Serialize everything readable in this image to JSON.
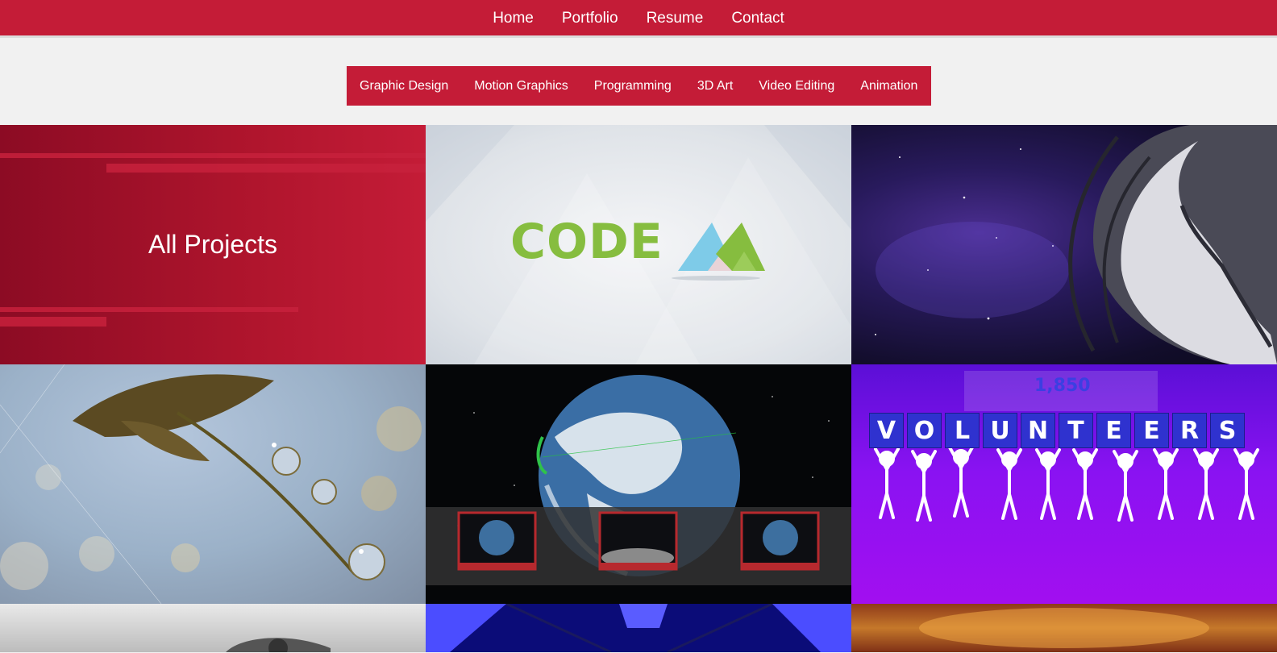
{
  "nav": {
    "items": [
      {
        "label": "Home"
      },
      {
        "label": "Portfolio"
      },
      {
        "label": "Resume"
      },
      {
        "label": "Contact"
      }
    ]
  },
  "categories": [
    {
      "label": "Graphic Design"
    },
    {
      "label": "Motion Graphics"
    },
    {
      "label": "Programming"
    },
    {
      "label": "3D Art"
    },
    {
      "label": "Video Editing"
    },
    {
      "label": "Animation"
    }
  ],
  "tiles": {
    "all_projects": {
      "label": "All Projects"
    },
    "code": {
      "word": "CODE"
    },
    "volunteers": {
      "count": "1,850",
      "letters": [
        "V",
        "O",
        "L",
        "U",
        "N",
        "T",
        "E",
        "E",
        "R",
        "S"
      ]
    }
  },
  "colors": {
    "brand_red": "#c41c37",
    "code_green": "#86bd3f",
    "code_blue": "#7ecbe8"
  }
}
